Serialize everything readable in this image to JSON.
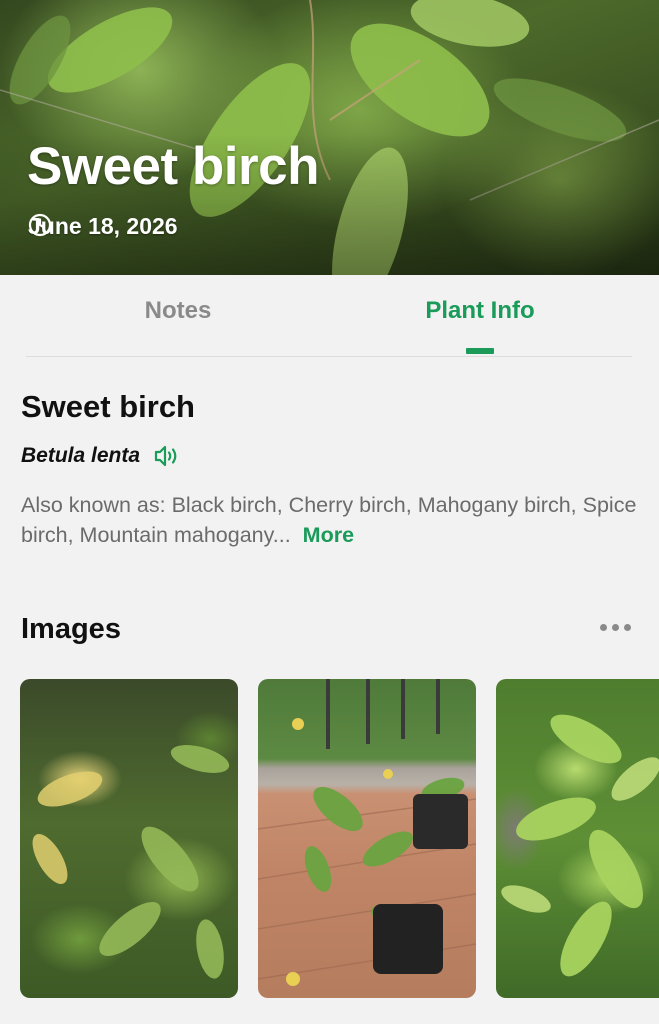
{
  "hero": {
    "title": "Sweet birch",
    "date": "June 18, 2026",
    "clock_icon": "clock-icon"
  },
  "tabs": [
    {
      "label": "Notes",
      "active": false
    },
    {
      "label": "Plant Info",
      "active": true
    }
  ],
  "plant": {
    "common_name": "Sweet birch",
    "scientific_name": "Betula lenta",
    "speaker_icon": "speaker-icon",
    "aka_text": "Also known as: Black birch, Cherry birch, Mahogany birch, Spice birch, Mountain mahogany...",
    "more_label": "More"
  },
  "images": {
    "title": "Images",
    "more_icon": "more-dots-icon",
    "thumbnails": [
      {
        "name": "image-thumbnail-1"
      },
      {
        "name": "image-thumbnail-2"
      },
      {
        "name": "image-thumbnail-3"
      }
    ]
  },
  "colors": {
    "accent": "#1a9b5a",
    "background": "#f2f2f2",
    "inactive_tab": "#8a8a8a",
    "secondary_text": "#6b6b6b"
  }
}
